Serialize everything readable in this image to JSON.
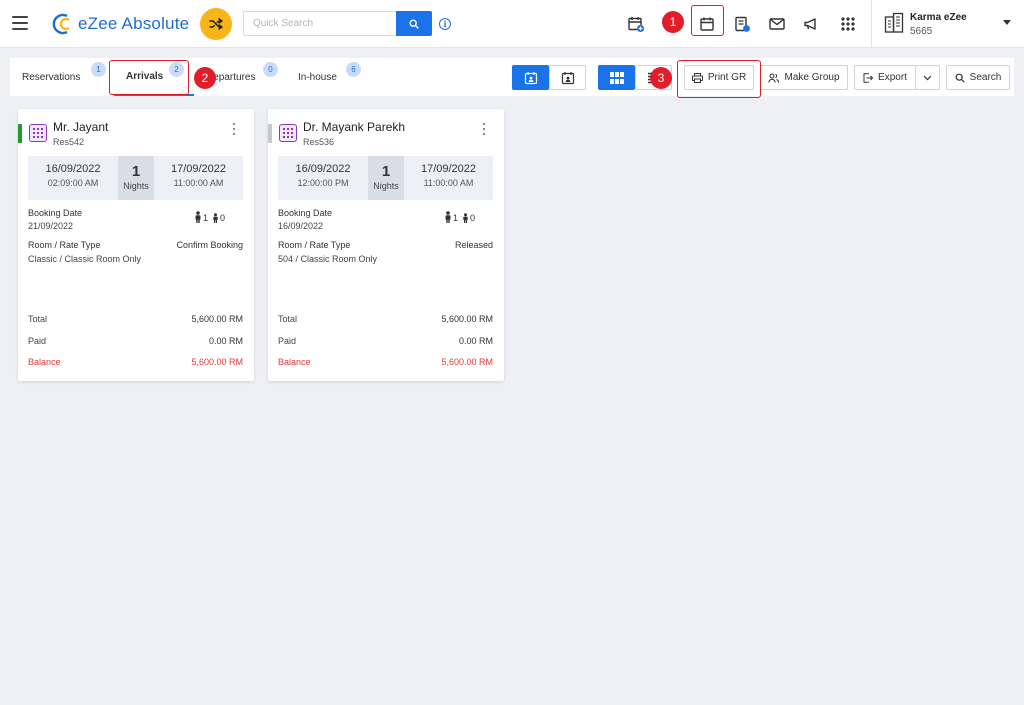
{
  "header": {
    "logo_text": "eZee Absolute",
    "search_placeholder": "Quick Search",
    "info_glyph": "i",
    "icons": [
      "menu-icon",
      "shuffle-icon",
      "search-icon",
      "info-icon",
      "calendar-add-icon",
      "reservation-list-icon",
      "calendar-icon",
      "invoice-icon",
      "mail-icon",
      "announcement-icon",
      "apps-grid-icon",
      "building-icon"
    ],
    "user": {
      "name": "Karma eZee",
      "id": "5665"
    }
  },
  "tabs": [
    {
      "label": "Reservations",
      "count": "1"
    },
    {
      "label": "Arrivals",
      "count": "2"
    },
    {
      "label": "Departures",
      "count": "0"
    },
    {
      "label": "In-house",
      "count": "6"
    }
  ],
  "toolbar": {
    "print_gr": "Print GR",
    "make_group": "Make Group",
    "export": "Export",
    "search": "Search"
  },
  "annotations": [
    "1",
    "2",
    "3"
  ],
  "colors": {
    "primary": "#1a73e8",
    "accent_yellow": "#f7b519",
    "annotation_red": "#e11d2b",
    "status_green": "#1e9b2c",
    "status_grey": "#c4c7cc",
    "balance_red": "#e53935",
    "room_icon_purple": "#8a3ab9"
  },
  "cards": [
    {
      "guest": "Mr. Jayant",
      "res_no": "Res542",
      "status_color": "#1e9b2c",
      "arrival_date": "16/09/2022",
      "arrival_time": "02:09:00 AM",
      "nights": "1",
      "nights_label": "Nights",
      "departure_date": "17/09/2022",
      "departure_time": "11:00:00 AM",
      "booking_date_label": "Booking Date",
      "booking_date": "21/09/2022",
      "adults": "1",
      "children": "0",
      "room_rate_label": "Room / Rate Type",
      "room_rate": "Classic / Classic Room Only",
      "status": "Confirm Booking",
      "total_label": "Total",
      "total": "5,600.00 RM",
      "paid_label": "Paid",
      "paid": "0.00 RM",
      "balance_label": "Balance",
      "balance": "5,600.00 RM"
    },
    {
      "guest": "Dr. Mayank Parekh",
      "res_no": "Res536",
      "status_color": "#c4c7cc",
      "arrival_date": "16/09/2022",
      "arrival_time": "12:00:00 PM",
      "nights": "1",
      "nights_label": "Nights",
      "departure_date": "17/09/2022",
      "departure_time": "11:00:00 AM",
      "booking_date_label": "Booking Date",
      "booking_date": "16/09/2022",
      "adults": "1",
      "children": "0",
      "room_rate_label": "Room / Rate Type",
      "room_rate": "504 / Classic Room Only",
      "status": "Released",
      "total_label": "Total",
      "total": "5,600.00 RM",
      "paid_label": "Paid",
      "paid": "0.00 RM",
      "balance_label": "Balance",
      "balance": "5,600.00 RM"
    }
  ]
}
